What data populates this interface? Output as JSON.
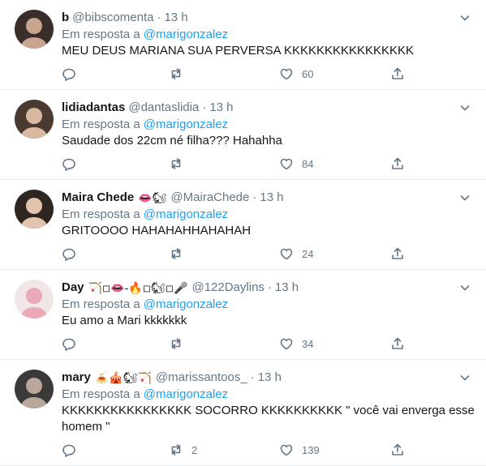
{
  "tweets": [
    {
      "name": "b",
      "name_emoji": "",
      "handle": "@bibscomenta",
      "sep": "·",
      "time": "13 h",
      "replying_prefix": "Em resposta a",
      "replying_to": "@marigonzalez",
      "text": "MEU DEUS MARIANA SUA PERVERSA KKKKKKKKKKKKKKKK",
      "replies": "",
      "retweets": "",
      "likes": "60"
    },
    {
      "name": "lidiadantas",
      "name_emoji": "",
      "handle": "@dantaslidia",
      "sep": "·",
      "time": "13 h",
      "replying_prefix": "Em resposta a",
      "replying_to": "@marigonzalez",
      "text": "Saudade dos 22cm né filha??? Hahahha",
      "replies": "",
      "retweets": "",
      "likes": "84"
    },
    {
      "name": "Maira Chede",
      "name_emoji": "👄🐿",
      "handle": "@MairaChede",
      "sep": "·",
      "time": "13 h",
      "replying_prefix": "Em resposta a",
      "replying_to": "@marigonzalez",
      "text": "GRITOOOO HAHAHAHHAHAHAH",
      "replies": "",
      "retweets": "",
      "likes": "24"
    },
    {
      "name": "Day",
      "name_emoji": "🏹◽👄-🔥◽🐿◽🎤",
      "handle": "@122Daylins",
      "sep": "·",
      "time": "13 h",
      "replying_prefix": "Em resposta a",
      "replying_to": "@marigonzalez",
      "text": "Eu amo a Mari kkkkkkk",
      "replies": "",
      "retweets": "",
      "likes": "34"
    },
    {
      "name": "mary",
      "name_emoji": "🍝🎪🐿🏹",
      "handle": "@marissantoos_",
      "sep": "·",
      "time": "13 h",
      "replying_prefix": "Em resposta a",
      "replying_to": "@marigonzalez",
      "text": "KKKKKKKKKKKKKKKK SOCORRO KKKKKKKKKK \" você vai enverga esse homem \"",
      "replies": "",
      "retweets": "2",
      "likes": "139"
    }
  ],
  "colors": {
    "link": "#1da1f2",
    "muted": "#657786",
    "text": "#14171a",
    "divider": "#e6ecf0"
  },
  "icons": [
    "reply-icon",
    "retweet-icon",
    "like-icon",
    "share-icon",
    "chevron-down-icon"
  ]
}
